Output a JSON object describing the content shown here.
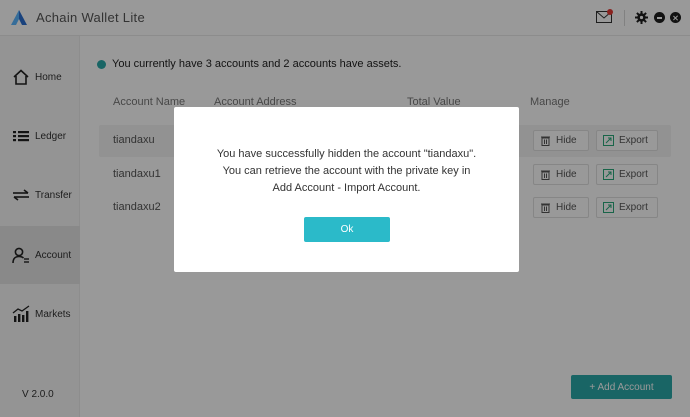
{
  "app": {
    "title": "Achain Wallet Lite",
    "version": "V  2.0.0"
  },
  "sidebar": {
    "items": [
      {
        "label": "Home",
        "icon": "home-icon"
      },
      {
        "label": "Ledger",
        "icon": "ledger-icon"
      },
      {
        "label": "Transfer",
        "icon": "transfer-icon"
      },
      {
        "label": "Account",
        "icon": "account-icon",
        "active": true
      },
      {
        "label": "Markets",
        "icon": "markets-icon"
      }
    ]
  },
  "summary": {
    "text": "You currently have 3 accounts and 2 accounts have assets."
  },
  "table": {
    "headers": [
      "Account Name",
      "Account Address",
      "Total Value",
      "Manage"
    ],
    "rows": [
      {
        "name": "tiandaxu"
      },
      {
        "name": "tiandaxu1"
      },
      {
        "name": "tiandaxu2"
      }
    ],
    "hide_label": "Hide",
    "export_label": "Export"
  },
  "add_account_label": "+ Add Account",
  "modal": {
    "lines": [
      "You have successfully hidden the account \"tiandaxu\".",
      "You can retrieve the account with the private key in",
      "Add Account - Import Account."
    ],
    "ok_label": "Ok"
  },
  "colors": {
    "accent": "#2aa8a8",
    "ok_button": "#2bbac9",
    "notification_dot": "#e53935"
  }
}
